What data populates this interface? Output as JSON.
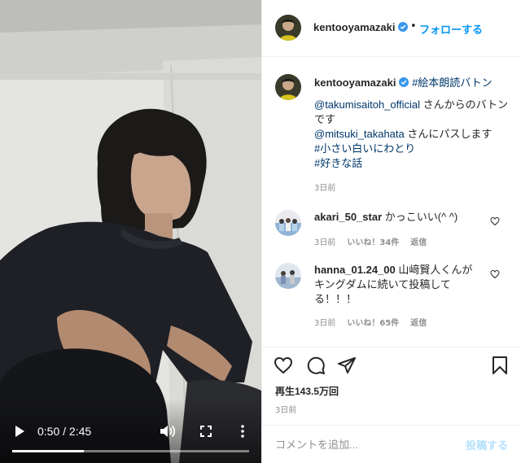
{
  "post": {
    "username": "kentooyamazaki",
    "follow_label": "フォローする",
    "separator": "•",
    "verified_icon": "verified-badge-icon",
    "accent_color": "#0095f6"
  },
  "video": {
    "current_time": "0:50",
    "duration": "2:45",
    "time_display": "0:50 / 2:45",
    "progress_fraction": 0.303
  },
  "caption": {
    "username": "kentooyamazaki",
    "hashtag_title": "#絵本朗読バトン",
    "mention_1": "@takumisaitoh_official",
    "text_1": " さんからのバトンです",
    "mention_2": "@mitsuki_takahata",
    "text_2": " さんにパスします",
    "hashtag_2": "#小さい白いにわとり",
    "hashtag_3": "#好きな話",
    "time": "3日前"
  },
  "comments": [
    {
      "username": "akari_50_star",
      "text": "かっこいい(^ ^)",
      "time": "3日前",
      "likes": "いいね！34件",
      "reply": "返信"
    },
    {
      "username": "hanna_01.24_00",
      "text": "山﨑賢人くんがキングダムに続いて投稿してる！！！",
      "time": "3日前",
      "likes": "いいね！65件",
      "reply": "返信"
    }
  ],
  "stats": {
    "views": "再生143.5万回",
    "time": "3日前"
  },
  "comment_form": {
    "placeholder": "コメントを追加...",
    "post_label": "投稿する"
  }
}
